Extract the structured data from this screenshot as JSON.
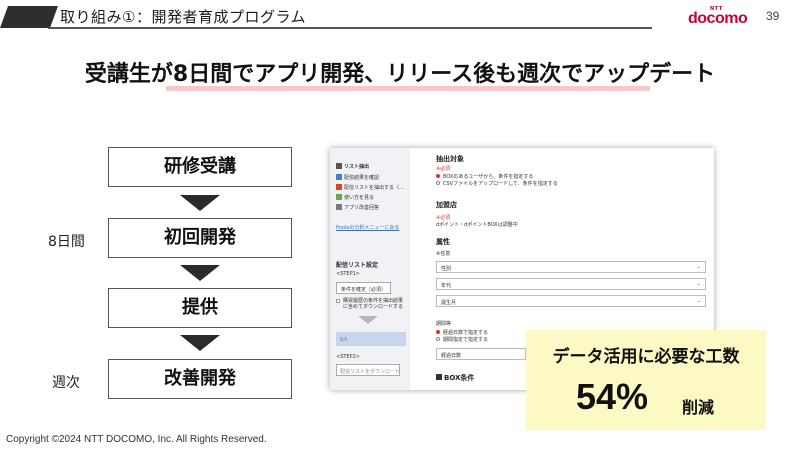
{
  "header": {
    "title": "取り組み①：開発者育成プログラム",
    "logo_small": "NTT",
    "logo_word": "docomo",
    "page_number": "39"
  },
  "headline": "受講生が8日間でアプリ開発、リリース後も週次でアップデート",
  "flow": {
    "steps": [
      "研修受講",
      "初回開発",
      "提供",
      "改善開発"
    ],
    "label_eight_days": "8日間",
    "label_weekly": "週次"
  },
  "mock": {
    "sidebar": {
      "title": "リスト抽出",
      "items": [
        "配信結果を確認",
        "配信リストを抽出する（...",
        "使い方を見る",
        "アプリ改善回答"
      ],
      "link": "Pooleの分析メニューに戻る",
      "section_title": "配信リスト設定",
      "step1": "<STEP1>",
      "step1_button": "条件を確定（必須）",
      "checkbox_text": "購買履歴の条件を抽出結果に含めてダウンロードする",
      "count_text": "0人",
      "step2": "<STEP2>",
      "download_button": "配信リストをダウンロード"
    },
    "main": {
      "extract_title": "抽出対象",
      "required": "※必須",
      "option1": "BOXのあるユーザから、条件を指定する",
      "option2": "CSVファイルをアップロードして、条件を指定する",
      "store_title": "加盟店",
      "store_text": "dポイント・dポイントBOXは調整中",
      "attr_title": "属性",
      "any": "※任意",
      "selects": [
        "性別",
        "年代",
        "誕生月"
      ],
      "period_title": "期間等",
      "period_opt1": "経過日数で指定する",
      "period_opt2": "期間指定で指定する",
      "elapsed": "経過日数",
      "box_title": "BOX条件"
    }
  },
  "callout": {
    "label": "データ活用に必要な工数",
    "value": "54%",
    "unit": "削減"
  },
  "copyright": "Copyright ©2024 NTT DOCOMO, Inc. All Rights Reserved.",
  "colors": {
    "brand": "#cc0033",
    "headline_underline": "#f7c7c9",
    "callout_bg": "#fdf9c4",
    "arrow": "#2a2a2a"
  }
}
